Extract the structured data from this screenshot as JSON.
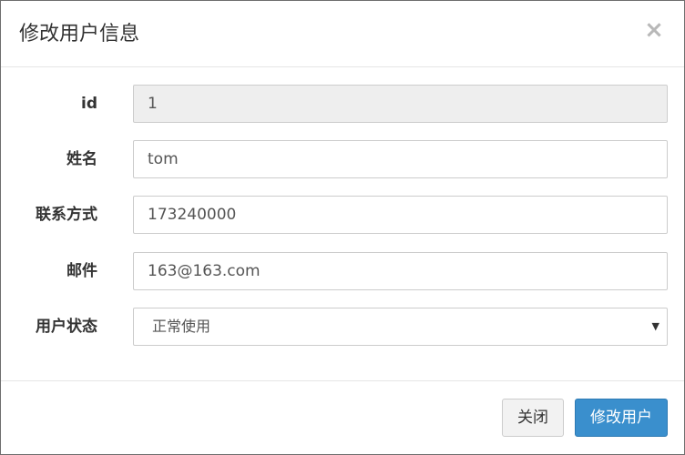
{
  "dialog": {
    "title": "修改用户信息",
    "close_symbol": "×"
  },
  "form": {
    "fields": [
      {
        "label": "id",
        "value": "1",
        "readonly": true
      },
      {
        "label": "姓名",
        "value": "tom"
      },
      {
        "label": "联系方式",
        "value": "173240000"
      },
      {
        "label": "邮件",
        "value": "163@163.com"
      }
    ],
    "status": {
      "label": "用户状态",
      "selected": "正常使用",
      "arrow": "▼"
    }
  },
  "footer": {
    "close_label": "关闭",
    "submit_label": "修改用户"
  }
}
